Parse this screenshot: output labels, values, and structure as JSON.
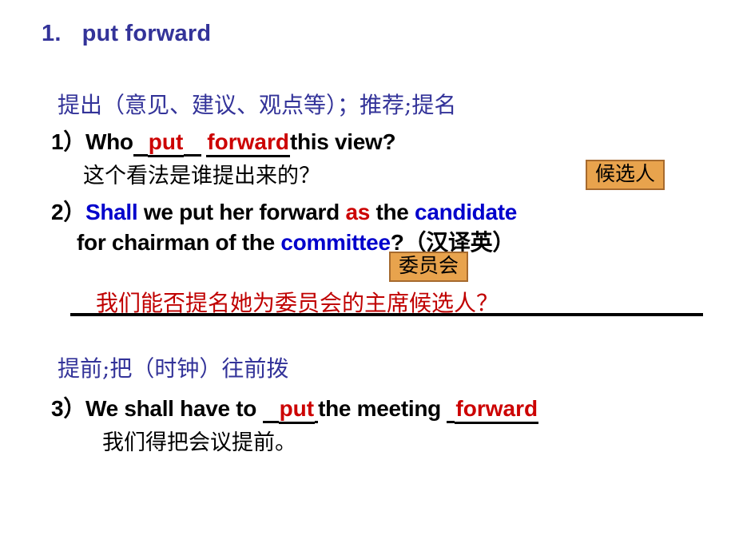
{
  "slide": {
    "title": {
      "number": "1.",
      "phrase": "put forward"
    },
    "sense_1": {
      "gloss": "提出（意见、建议、观点等）；推荐;提名",
      "examples": [
        {
          "marker": "1）",
          "seg_before": "Who",
          "blank_1": "put",
          "blank_2": "forward",
          "seg_after": "this view?",
          "translation": "这个看法是谁提出来的？"
        },
        {
          "marker": "2）",
          "word_shall": "Shall",
          "seg_mid_1": " we put her forward ",
          "word_as": "as",
          "seg_mid_2": " the ",
          "word_candidate": "candidate",
          "line2_before": "for chairman of the ",
          "word_committee": "committee",
          "line2_after": "?（汉译英）",
          "answer": "我们能否提名她为委员会的主席候选人？"
        }
      ],
      "callouts": [
        {
          "text": "候选人"
        },
        {
          "text": "委员会"
        }
      ]
    },
    "sense_2": {
      "gloss": "提前;把（时钟）往前拨",
      "examples": [
        {
          "marker": "3）",
          "seg_before": "We shall have to ",
          "blank_1": "put",
          "seg_mid": "the meeting ",
          "blank_2": "forward",
          "translation": "我们得把会议提前。"
        }
      ]
    },
    "colors": {
      "title_navy": "#333399",
      "gloss_navy": "#333399",
      "highlight_red": "#CC0000",
      "answer_red": "#C00000",
      "highlight_blue": "#0000CC",
      "callout_fill": "#E8A34D",
      "callout_border": "#A66A2E",
      "body_black": "#000000",
      "background": "#FFFFFF"
    }
  }
}
